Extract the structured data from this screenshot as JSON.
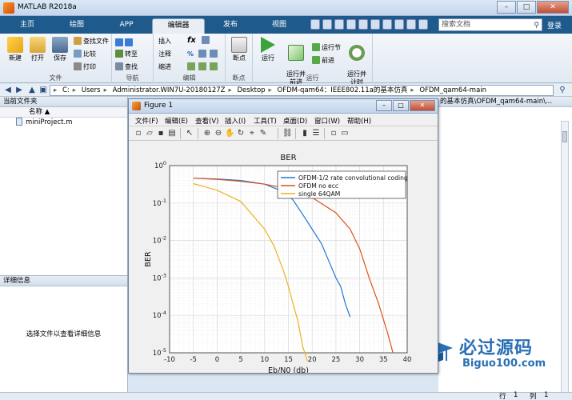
{
  "window": {
    "title": "MATLAB R2018a",
    "minimize": "–",
    "maximize": "□",
    "close": "✕"
  },
  "ribbon_tabs": [
    {
      "label": "主页"
    },
    {
      "label": "绘图"
    },
    {
      "label": "APP"
    },
    {
      "label": "编辑器"
    },
    {
      "label": "发布"
    },
    {
      "label": "视图"
    }
  ],
  "active_tab": "编辑器",
  "search": {
    "placeholder": "搜索文档"
  },
  "login_label": "登录",
  "ribbon": {
    "file": {
      "group_label": "文件",
      "new": "新建",
      "open": "打开",
      "save": "保存",
      "find_files": "查找文件",
      "compare": "比较",
      "print": "打印"
    },
    "navigate": {
      "group_label": "导航",
      "goto": "转至",
      "find": "查找"
    },
    "edit": {
      "group_label": "编辑",
      "insert": "插入",
      "comment": "注释",
      "indent": "缩进",
      "fx": "fx",
      "percent": "%"
    },
    "breakpoints": {
      "group_label": "断点",
      "breakpoints": "断点"
    },
    "run": {
      "group_label": "运行",
      "run": "运行",
      "run_advance": "运行并\n前进",
      "run_section": "运行节",
      "advance": "前进",
      "run_time": "运行并\n计时"
    }
  },
  "address": {
    "segments": [
      "C:",
      "Users",
      "Administrator.WIN7U-20180127Z",
      "Desktop",
      "OFDM-qam64：IEEE802.11a的基本仿真",
      "OFDM_qam64-main"
    ]
  },
  "current_folder": {
    "title": "当前文件夹",
    "column_name": "名称 ▲",
    "files": [
      "miniProject.m"
    ]
  },
  "details": {
    "title": "详细信息",
    "message": "选择文件以查看详细信息"
  },
  "right_panel": {
    "path_text": "的基本仿真\\OFDM_qam64-main\\..."
  },
  "statusbar": {
    "row_label": "行",
    "row_value": "1",
    "col_label": "列",
    "col_value": "1"
  },
  "watermark": {
    "title": "必过源码",
    "url": "Biguo100.com"
  },
  "figure": {
    "title": "Figure 1",
    "menu": [
      "文件(F)",
      "编辑(E)",
      "查看(V)",
      "插入(I)",
      "工具(T)",
      "桌面(D)",
      "窗口(W)",
      "帮助(H)"
    ],
    "toolbar_icons": [
      "new-figure-icon",
      "open-icon",
      "save-icon",
      "print-icon",
      "pointer-icon",
      "zoom-in-icon",
      "zoom-out-icon",
      "pan-icon",
      "rotate-icon",
      "data-cursor-icon",
      "brush-icon",
      "link-icon",
      "colorbar-icon",
      "legend-icon",
      "hide-tools-icon",
      "show-tools-icon"
    ]
  },
  "chart_data": {
    "type": "line",
    "title": "BER",
    "xlabel": "Eb/N0 (db)",
    "ylabel": "BER",
    "xlim": [
      -10,
      40
    ],
    "ylim": [
      1e-05,
      1
    ],
    "yscale": "log",
    "grid": true,
    "legend_position": "top-right",
    "x_ticks": [
      "-10",
      "-5",
      "0",
      "5",
      "10",
      "15",
      "20",
      "25",
      "30",
      "35",
      "40"
    ],
    "y_ticks": [
      {
        "base": "10",
        "exp": "0",
        "value": 1
      },
      {
        "base": "10",
        "exp": "-1",
        "value": 0.1
      },
      {
        "base": "10",
        "exp": "-2",
        "value": 0.01
      },
      {
        "base": "10",
        "exp": "-3",
        "value": 0.001
      },
      {
        "base": "10",
        "exp": "-4",
        "value": 0.0001
      },
      {
        "base": "10",
        "exp": "-5",
        "value": 1e-05
      }
    ],
    "series": [
      {
        "name": "OFDM-1/2 rate convolutional coding",
        "color": "#1f77d4",
        "x": [
          -5,
          0,
          5,
          10,
          14,
          16,
          18,
          20,
          22,
          23,
          24,
          25,
          26,
          27,
          28
        ],
        "y": [
          0.46,
          0.44,
          0.4,
          0.32,
          0.2,
          0.12,
          0.05,
          0.02,
          0.008,
          0.004,
          0.002,
          0.001,
          0.0006,
          0.0002,
          9e-05
        ]
      },
      {
        "name": "OFDM no ecc",
        "color": "#d95319",
        "x": [
          -5,
          0,
          5,
          10,
          15,
          20,
          25,
          28,
          30,
          32,
          34,
          36,
          37
        ],
        "y": [
          0.46,
          0.43,
          0.38,
          0.32,
          0.24,
          0.14,
          0.055,
          0.02,
          0.006,
          0.001,
          0.0002,
          3e-05,
          1e-05
        ]
      },
      {
        "name": "single 64QAM",
        "color": "#edb120",
        "x": [
          -5,
          0,
          5,
          10,
          12,
          14,
          15,
          16,
          17,
          18,
          19
        ],
        "y": [
          0.33,
          0.22,
          0.11,
          0.02,
          0.007,
          0.0015,
          0.0006,
          0.0002,
          7e-05,
          1.5e-05,
          6e-06
        ]
      }
    ]
  }
}
